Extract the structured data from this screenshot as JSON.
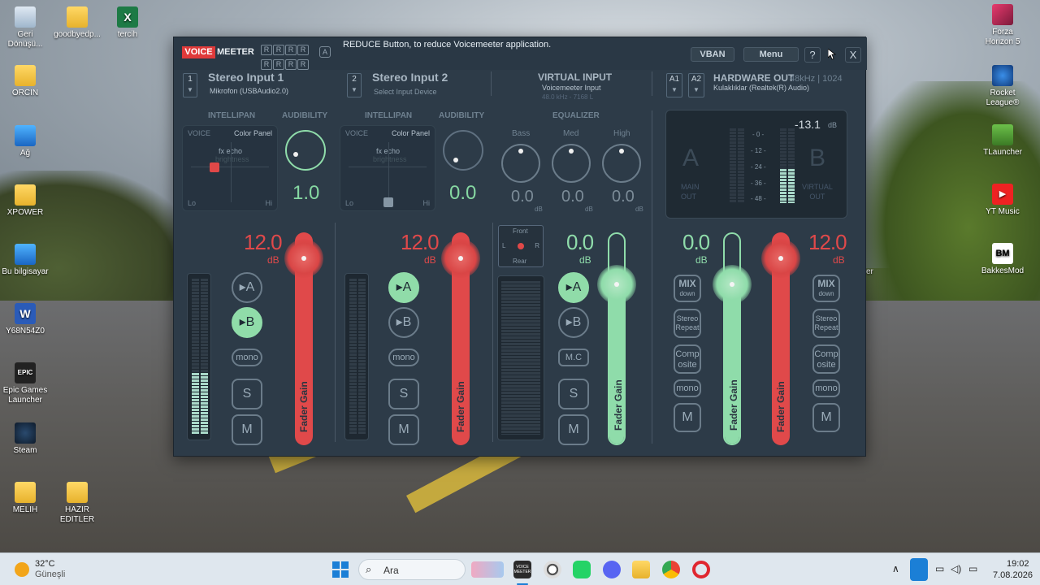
{
  "desktop": {
    "icons_left": [
      {
        "label": "Geri\nDönüşü...",
        "icon": "recycle-bin-icon"
      },
      {
        "label": "goodbyedp...",
        "icon": "folder-icon"
      },
      {
        "label": "tercih",
        "icon": "excel-icon"
      },
      {
        "label": "ORCIN",
        "icon": "folder-icon"
      },
      {
        "label": "Ağ",
        "icon": "network-icon"
      },
      {
        "label": "XPOWER",
        "icon": "folder-icon"
      },
      {
        "label": "Bu bilgisayar",
        "icon": "computer-icon"
      },
      {
        "label": "Y68N54Z0",
        "icon": "word-icon"
      },
      {
        "label": "Epic Games\nLauncher",
        "icon": "epic-games-icon"
      },
      {
        "label": "Steam",
        "icon": "steam-icon"
      },
      {
        "label": "MELIH",
        "icon": "folder-icon"
      },
      {
        "label": "HAZIR\nEDITLER",
        "icon": "folder-icon"
      }
    ],
    "icons_right": [
      {
        "label": "Forza\nHorizon 5",
        "icon": "forza-icon"
      },
      {
        "label": "Rocket\nLeague®",
        "icon": "rocket-league-icon"
      },
      {
        "label": "TLauncher",
        "icon": "tlauncher-icon"
      },
      {
        "label": "YT Music",
        "icon": "yt-music-icon"
      },
      {
        "label": "BakkesMod",
        "icon": "bakkesmod-icon"
      }
    ],
    "partial_label": "er"
  },
  "voicemeeter": {
    "logo_voice": "VOICE",
    "logo_meeter": "MEETER",
    "r_grid": [
      "R",
      "R",
      "R",
      "R",
      "R",
      "R",
      "R",
      "R"
    ],
    "a_badge": "A",
    "message": "REDUCE Button, to reduce Voicemeeter application.",
    "vban_label": "VBAN",
    "menu_label": "Menu",
    "help_label": "?",
    "close_label": "X",
    "strip1": {
      "num": "1",
      "name": "Stereo Input 1",
      "device": "Mikrofon (USBAudio2.0)",
      "intellipan": "INTELLIPAN",
      "audibility": "AUDIBILITY",
      "voice": "VOICE",
      "color_panel": "Color Panel",
      "fx_echo": "fx echo",
      "brightness": "brightness",
      "lo": "Lo",
      "hi": "Hi",
      "audibility_value": "1.0",
      "gain": "12.0",
      "db": "dB",
      "btn_a": "▸A",
      "btn_b": "▸B",
      "mono": "mono",
      "solo": "S",
      "mute": "M",
      "fader_label": "Fader Gain"
    },
    "strip2": {
      "num": "2",
      "name": "Stereo Input 2",
      "device": "Select Input Device",
      "intellipan": "INTELLIPAN",
      "audibility": "AUDIBILITY",
      "voice": "VOICE",
      "color_panel": "Color Panel",
      "fx_echo": "fx echo",
      "brightness": "brightness",
      "lo": "Lo",
      "hi": "Hi",
      "audibility_value": "0.0",
      "gain": "12.0",
      "db": "dB",
      "btn_a": "▸A",
      "btn_b": "▸B",
      "mono": "mono",
      "solo": "S",
      "mute": "M",
      "fader_label": "Fader Gain"
    },
    "virtual": {
      "title": "VIRTUAL INPUT",
      "device": "Voicemeeter Input",
      "format": "48.0 kHz - 7168 L",
      "equalizer": "EQUALIZER",
      "bass": "Bass",
      "med": "Med",
      "high": "High",
      "bass_val": "0.0",
      "med_val": "0.0",
      "high_val": "0.0",
      "db": "dB",
      "front": "Front",
      "rear": "Rear",
      "l": "L",
      "r": "R",
      "gain": "0.0",
      "btn_a": "▸A",
      "btn_b": "▸B",
      "mc": "M.C",
      "solo": "S",
      "mute": "M",
      "fader_label": "Fader Gain"
    },
    "hardware": {
      "a1": "A1",
      "a2": "A2",
      "title": "HARDWARE OUT",
      "format": "48kHz | 1024",
      "device": "Kulaklıklar (Realtek(R) Audio)",
      "level": "-13.1",
      "db": "dB",
      "scale": [
        "- 0 -",
        "- 12 -",
        "- 24 -",
        "- 36 -",
        "- 48 -"
      ],
      "a_big": "A",
      "b_big": "B",
      "main_out": "MAIN\nOUT",
      "virtual_out": "VIRTUAL\nOUT"
    },
    "bus_a": {
      "gain": "0.0",
      "db": "dB",
      "mix": "MIX",
      "mix_sub": "down",
      "stereo": "Stereo\nRepeat",
      "comp": "Comp\nosite",
      "mono": "mono",
      "mute": "M",
      "fader_label": "Fader Gain"
    },
    "bus_b": {
      "gain": "12.0",
      "db": "dB",
      "mix": "MIX",
      "mix_sub": "down",
      "stereo": "Stereo\nRepeat",
      "comp": "Comp\nosite",
      "mono": "mono",
      "mute": "M",
      "fader_label": "Fader Gain"
    }
  },
  "taskbar": {
    "weather_temp": "32°C",
    "weather_desc": "Güneşli",
    "search_placeholder": "Ara",
    "vm_label": "VOICE\nMEETER",
    "time": "19:02",
    "date": "7.08.2026"
  },
  "colors": {
    "accent_red": "#e0494a",
    "accent_green": "#8fdcaa",
    "panel": "#2d3b48"
  }
}
